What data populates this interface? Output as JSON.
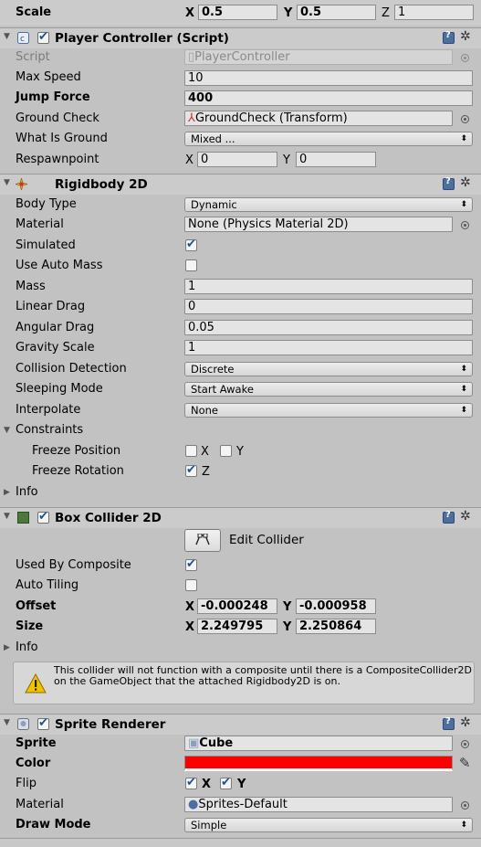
{
  "transform": {
    "scale_label": "Scale",
    "x": "X",
    "x_val": "0.5",
    "y": "Y",
    "y_val": "0.5",
    "z": "Z",
    "z_val": "1"
  },
  "player_controller": {
    "title": "Player Controller (Script)",
    "script_label": "Script",
    "script_val": "PlayerController",
    "max_speed_label": "Max Speed",
    "max_speed_val": "10",
    "jump_force_label": "Jump Force",
    "jump_force_val": "400",
    "ground_check_label": "Ground Check",
    "ground_check_val": "GroundCheck (Transform)",
    "what_is_ground_label": "What Is Ground",
    "what_is_ground_val": "Mixed ...",
    "respawn_label": "Respawnpoint",
    "respawn_x": "X",
    "respawn_x_val": "0",
    "respawn_y": "Y",
    "respawn_y_val": "0"
  },
  "rigidbody": {
    "title": "Rigidbody 2D",
    "body_type_label": "Body Type",
    "body_type_val": "Dynamic",
    "material_label": "Material",
    "material_val": "None (Physics Material 2D)",
    "simulated_label": "Simulated",
    "simulated": true,
    "auto_mass_label": "Use Auto Mass",
    "auto_mass": false,
    "mass_label": "Mass",
    "mass_val": "1",
    "linear_drag_label": "Linear Drag",
    "linear_drag_val": "0",
    "angular_drag_label": "Angular Drag",
    "angular_drag_val": "0.05",
    "gravity_label": "Gravity Scale",
    "gravity_val": "1",
    "collision_label": "Collision Detection",
    "collision_val": "Discrete",
    "sleeping_label": "Sleeping Mode",
    "sleeping_val": "Start Awake",
    "interpolate_label": "Interpolate",
    "interpolate_val": "None",
    "constraints_label": "Constraints",
    "freeze_pos_label": "Freeze Position",
    "freeze_pos_x": "X",
    "freeze_pos_y": "Y",
    "freeze_rot_label": "Freeze Rotation",
    "freeze_rot_z": "Z",
    "info_label": "Info"
  },
  "box_collider": {
    "title": "Box Collider 2D",
    "edit_label": "Edit Collider",
    "composite_label": "Used By Composite",
    "composite": true,
    "auto_tiling_label": "Auto Tiling",
    "auto_tiling": false,
    "offset_label": "Offset",
    "offset_x": "X",
    "offset_x_val": "-0.000248",
    "offset_y": "Y",
    "offset_y_val": "-0.000958",
    "size_label": "Size",
    "size_x": "X",
    "size_x_val": "2.249795",
    "size_y": "Y",
    "size_y_val": "2.250864",
    "info_label": "Info",
    "warning": "This collider will not function with a composite until there is a CompositeCollider2D on the GameObject that the attached Rigidbody2D is on."
  },
  "sprite_renderer": {
    "title": "Sprite Renderer",
    "sprite_label": "Sprite",
    "sprite_val": "Cube",
    "color_label": "Color",
    "color_val": "#ff0000",
    "flip_label": "Flip",
    "flip_x": "X",
    "flip_y": "Y",
    "material_label": "Material",
    "material_val": "Sprites-Default",
    "draw_mode_label": "Draw Mode",
    "draw_mode_val": "Simple"
  },
  "icons": [
    "script-icon",
    "rigidbody-icon",
    "box-collider-icon",
    "sprite-renderer-icon",
    "help-book-icon",
    "gear-icon",
    "warning-icon",
    "edit-collider-icon",
    "object-picker-icon",
    "eyedropper-icon"
  ]
}
